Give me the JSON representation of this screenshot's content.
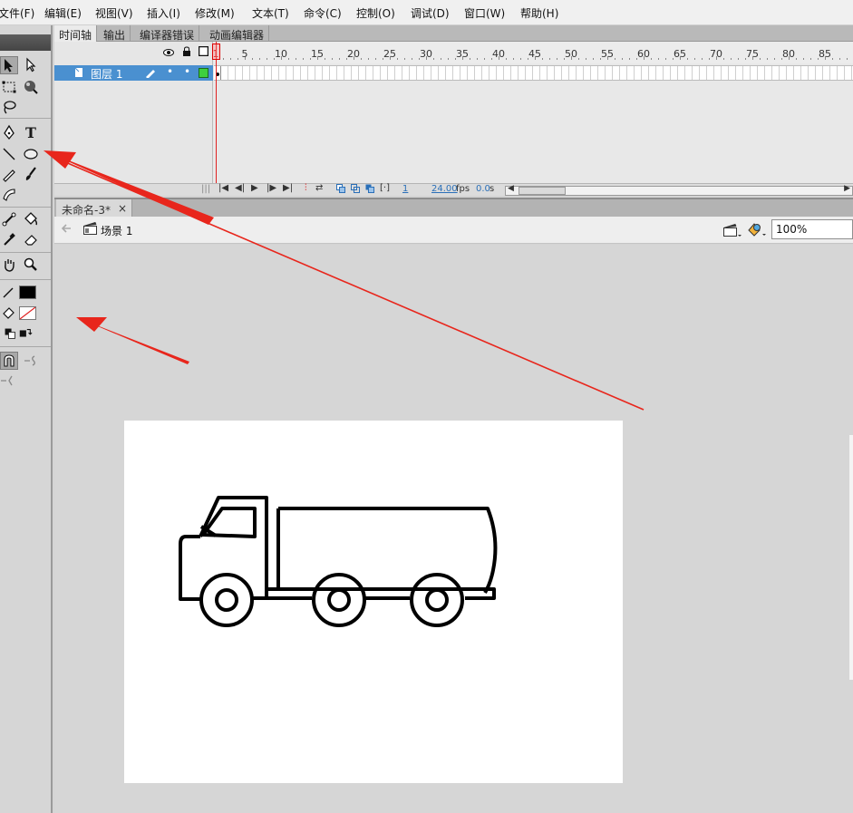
{
  "menu": [
    "文件(F)",
    "编辑(E)",
    "视图(V)",
    "插入(I)",
    "修改(M)",
    "文本(T)",
    "命令(C)",
    "控制(O)",
    "调试(D)",
    "窗口(W)",
    "帮助(H)"
  ],
  "panel_tabs": [
    "时间轴",
    "输出",
    "编译器错误",
    "动画编辑器"
  ],
  "timeline": {
    "layer_name": "图层 1",
    "frame_ticks": [
      "1",
      "5",
      "10",
      "15",
      "20",
      "25",
      "30",
      "35",
      "40",
      "45",
      "50",
      "55",
      "60",
      "65",
      "70",
      "75",
      "80",
      "85"
    ],
    "current_frame": "1",
    "fps": "24.00",
    "fps_unit": "fps",
    "time": "0.0",
    "time_unit": "s"
  },
  "document": {
    "tab_label": "未命名-3*",
    "close_glyph": "×",
    "scene_label": "场景 1",
    "zoom": "100%"
  },
  "colors": {
    "arrow": "#e8261c",
    "stroke_swatch": "#000000",
    "layer_highlight": "#4a90d0",
    "stage": "#ffffff"
  }
}
